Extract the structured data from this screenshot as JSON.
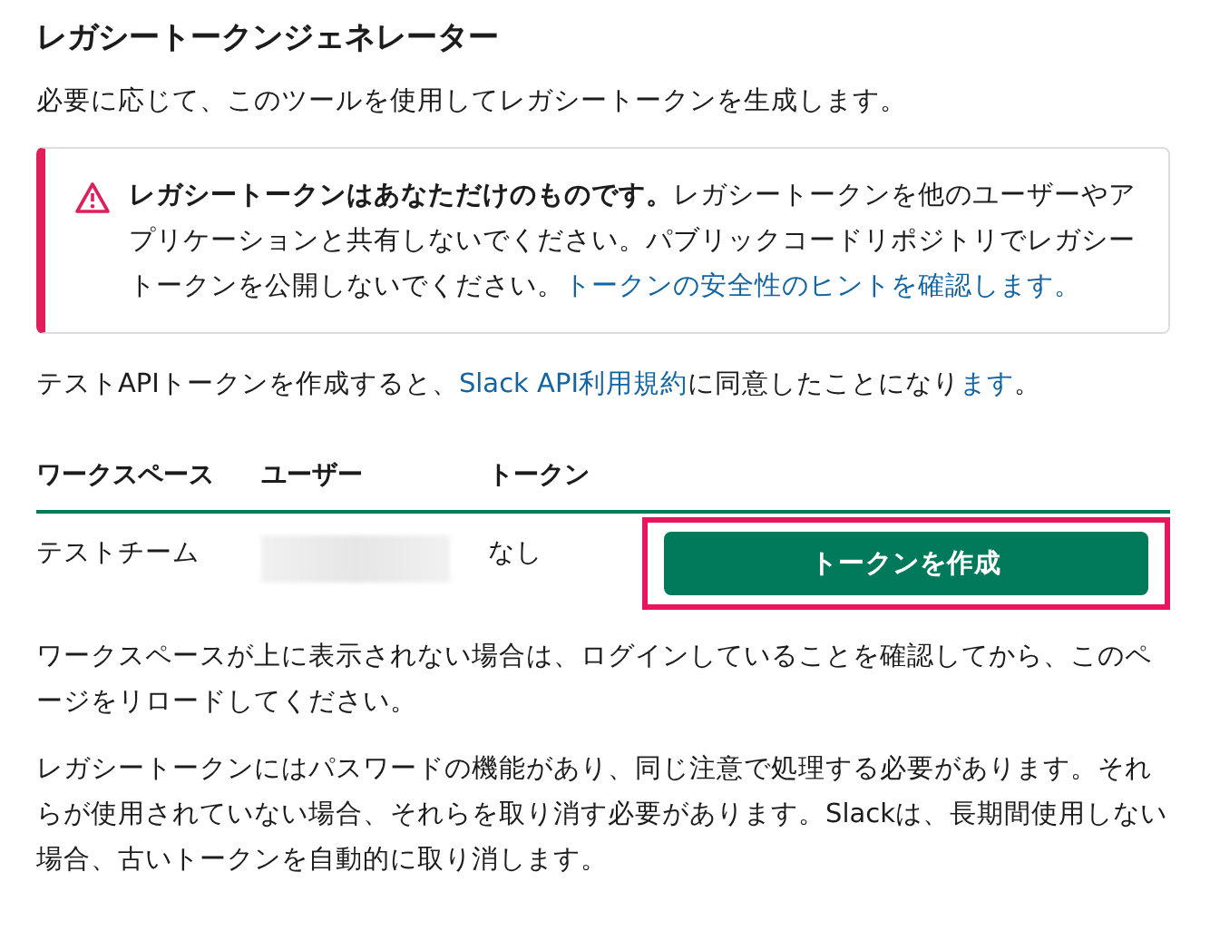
{
  "title": "レガシートークンジェネレーター",
  "subtitle": "必要に応じて、このツールを使用してレガシートークンを生成します。",
  "alert": {
    "text": "**レガシートークンはあなただけのものです。**レガシートークンを他のユーザーやアプリケーションと共有しないでください。パブリックコードリポジトリでレガシートークンを公開しないでください。",
    "link": "トークンの安全性のヒントを確認します。"
  },
  "terms": [
    {
      "kind": "text",
      "text": "テストAPIトークンを作成すると、"
    },
    {
      "kind": "link",
      "text": "Slack API利用規約"
    },
    {
      "kind": "text",
      "text": "に同意したことになり"
    },
    {
      "kind": "link",
      "text": "ます"
    },
    {
      "kind": "text",
      "text": "。"
    }
  ],
  "table": {
    "columns": [
      "ワークスペース",
      "ユーザー",
      "トークン"
    ],
    "rows": [
      {
        "workspace": "テストチーム",
        "user_redacted": true,
        "token": "なし",
        "button": "トークンを作成",
        "highlighted": true
      }
    ]
  },
  "notes": [
    "ワークスペースが上に表示されない場合は、ログインしていることを確認してから、このページをリロードしてください。",
    "レガシートークンにはパスワードの機能があり、同じ注意で処理する必要があります。それらが使用されていない場合、それらを取り消す必要があります。Slackは、長期間使用しない場合、古いトークンを自動的に取り消します。"
  ]
}
